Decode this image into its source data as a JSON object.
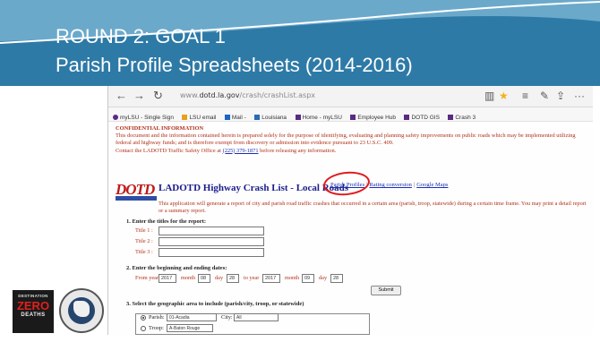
{
  "slide": {
    "title": "ROUND 2: GOAL 1",
    "subtitle": "Parish Profile Spreadsheets (2014-2016)"
  },
  "browser": {
    "back_icon": "back-arrow-icon",
    "forward_icon": "forward-arrow-icon",
    "refresh_icon": "refresh-icon",
    "url_prefix": "www.",
    "url_domain": "dotd.la.gov",
    "url_path": "/crash/crashList.aspx",
    "favorites": [
      "myLSU - Single Sign",
      "LSU email",
      "Mail -",
      "Louisiana",
      "Home - myLSU",
      "Employee Hub",
      "DOTD GIS",
      "Crash 3"
    ]
  },
  "confidential": {
    "heading": "CONFIDENTIAL INFORMATION",
    "line1": "This document and the information contained herein is prepared solely for the purpose of identifying, evaluating and planning safety improvements on public roads which may be implemented utilizing federal aid highway funds; and is therefore exempt from discovery or admission into evidence pursuant to 23 U.S.C. 409.",
    "line2_prefix": "Contact the LADOTD Traffic Safety Office at",
    "phone": "(225) 379-1871",
    "line2_suffix": "before releasing any information."
  },
  "page": {
    "logo_text": "DOTD",
    "heading": "LADOTD Highway Crash List - Local Roads",
    "links": [
      "Parish Profiles",
      "Rating conversion",
      "Google Maps"
    ],
    "description": "This application will generate a report of city and parish road traffic crashes that occurred in a certain area (parish, troop, statewide) during a certain time frame. You may print a detail report or a summary report."
  },
  "form": {
    "section1": "1.  Enter the titles for the report:",
    "title_labels": [
      "Title 1 :",
      "Title 2 :",
      "Title 3 :"
    ],
    "section2": "2.  Enter the beginning and ending dates:",
    "from_year_label": "From year",
    "from_year": "2017",
    "month_label": "month",
    "from_month": "08",
    "day_label": "day",
    "from_day": "28",
    "to_year_label": "to year",
    "to_year": "2017",
    "to_month": "09",
    "to_day": "28",
    "submit_label": "Submit",
    "section3": "3.  Select the geographic area to include (parish/city, troop, or statewide)",
    "parish_label": "Parish:",
    "parish_value": "01-Acadia",
    "city_label": "City:",
    "city_value": "All",
    "troop_label": "Troop:",
    "troop_value": "A-Baton Rouge"
  },
  "logos": {
    "zero_top": "DESTINATION",
    "zero_main": "ZERO",
    "zero_bottom": "DEATHS"
  },
  "colors": {
    "header_blue": "#2e7aa7",
    "annotation_red": "#e0191c",
    "warning_text": "#b33018",
    "link_blue": "#1a2fb0"
  }
}
